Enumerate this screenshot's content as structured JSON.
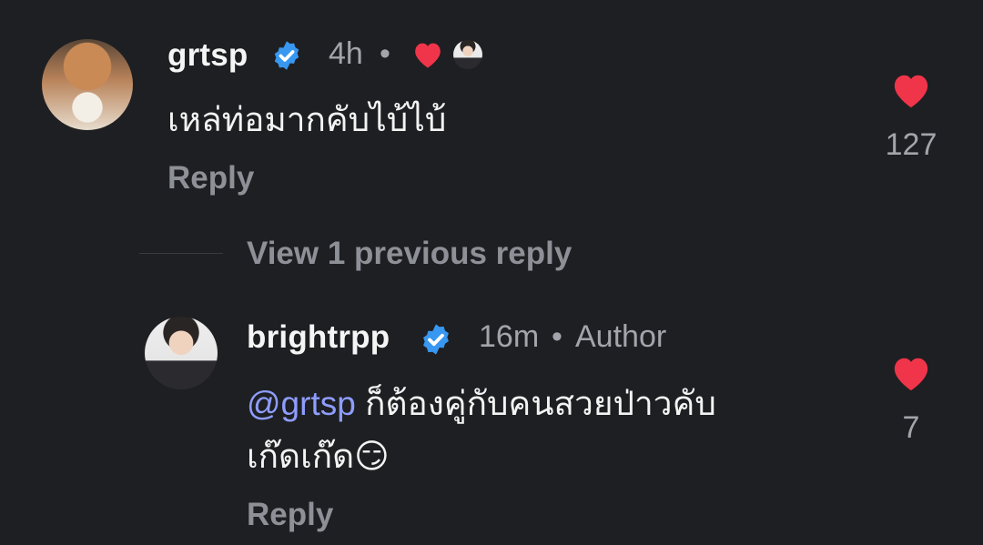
{
  "comment": {
    "username": "grtsp",
    "time": "4h",
    "separator": "•",
    "text": "เหล่ท่อมากคับไบ้ไบ้",
    "reply_label": "Reply",
    "like_count": "127"
  },
  "thread": {
    "view_previous": "View 1 previous reply"
  },
  "reply": {
    "username": "brightrpp",
    "time": "16m",
    "separator": "•",
    "author_label": "Author",
    "mention": "@grtsp",
    "text_line1": " ก็ต้องคู่กับคนสวยป่าวคับ",
    "text_line2": "เก๊ดเก๊ด",
    "emoji": "😏",
    "reply_label": "Reply",
    "like_count": "7"
  },
  "icons": {
    "verified": "verified-badge-icon",
    "liked_by_author": "red-heart-icon",
    "like": "heart-icon"
  },
  "colors": {
    "background": "#1e1f22",
    "heart": "#f0354a",
    "verified": "#3897f0",
    "mention": "#8e9dff",
    "muted": "#8e9097"
  }
}
